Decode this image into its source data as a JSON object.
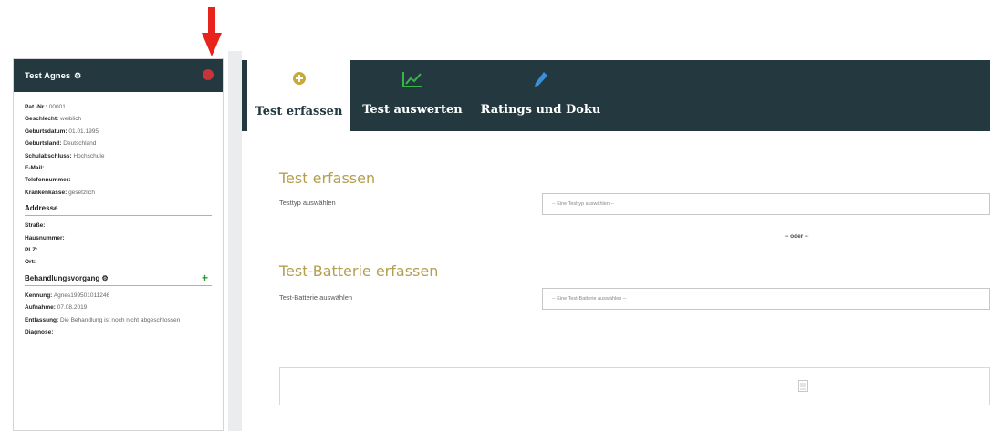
{
  "patient": {
    "name": "Test Agnes",
    "fields": [
      {
        "label": "Pat.-Nr.:",
        "value": "00001"
      },
      {
        "label": "Geschlecht:",
        "value": "weiblich"
      },
      {
        "label": "Geburtsdatum:",
        "value": "01.01.1995"
      },
      {
        "label": "Geburtsland:",
        "value": "Deutschland"
      },
      {
        "label": "Schulabschluss:",
        "value": "Hochschule"
      },
      {
        "label": "E-Mail:",
        "value": ""
      },
      {
        "label": "Telefonnummer:",
        "value": ""
      },
      {
        "label": "Krankenkasse:",
        "value": "gesetzlich"
      }
    ]
  },
  "address": {
    "title": "Addresse",
    "fields": [
      {
        "label": "Straße:",
        "value": ""
      },
      {
        "label": "Hausnummer:",
        "value": ""
      },
      {
        "label": "PLZ:",
        "value": ""
      },
      {
        "label": "Ort:",
        "value": ""
      }
    ]
  },
  "treatment": {
    "title": "Behandlungsvorgang",
    "plus": "+",
    "fields": [
      {
        "label": "Kennung:",
        "value": "Agnes199501011246"
      },
      {
        "label": "Aufnahme:",
        "value": "07.08.2019"
      },
      {
        "label": "Entlassung:",
        "value": "Die Behandlung ist noch nicht abgeschlossen"
      },
      {
        "label": "Diagnose:",
        "value": ""
      }
    ]
  },
  "tabs": [
    {
      "label": "Test erfassen",
      "icon": "plus-circle-icon"
    },
    {
      "label": "Test auswerten",
      "icon": "chart-icon"
    },
    {
      "label": "Ratings und Doku",
      "icon": "pencil-icon"
    }
  ],
  "test_section": {
    "title": "Test erfassen",
    "label": "Testtyp auswählen",
    "placeholder": "-- Eine Testtyp auswählen --"
  },
  "oder": "-- oder --",
  "battery_section": {
    "title": "Test-Batterie erfassen",
    "label": "Test-Batterie auswählen",
    "placeholder": "-- Eine Test-Batterie auswählen --"
  },
  "colors": {
    "header_dark": "#23393f",
    "accent_gold": "#b39f4f",
    "annotation_red": "#e8231c",
    "plus_green": "#2f9a2f"
  }
}
